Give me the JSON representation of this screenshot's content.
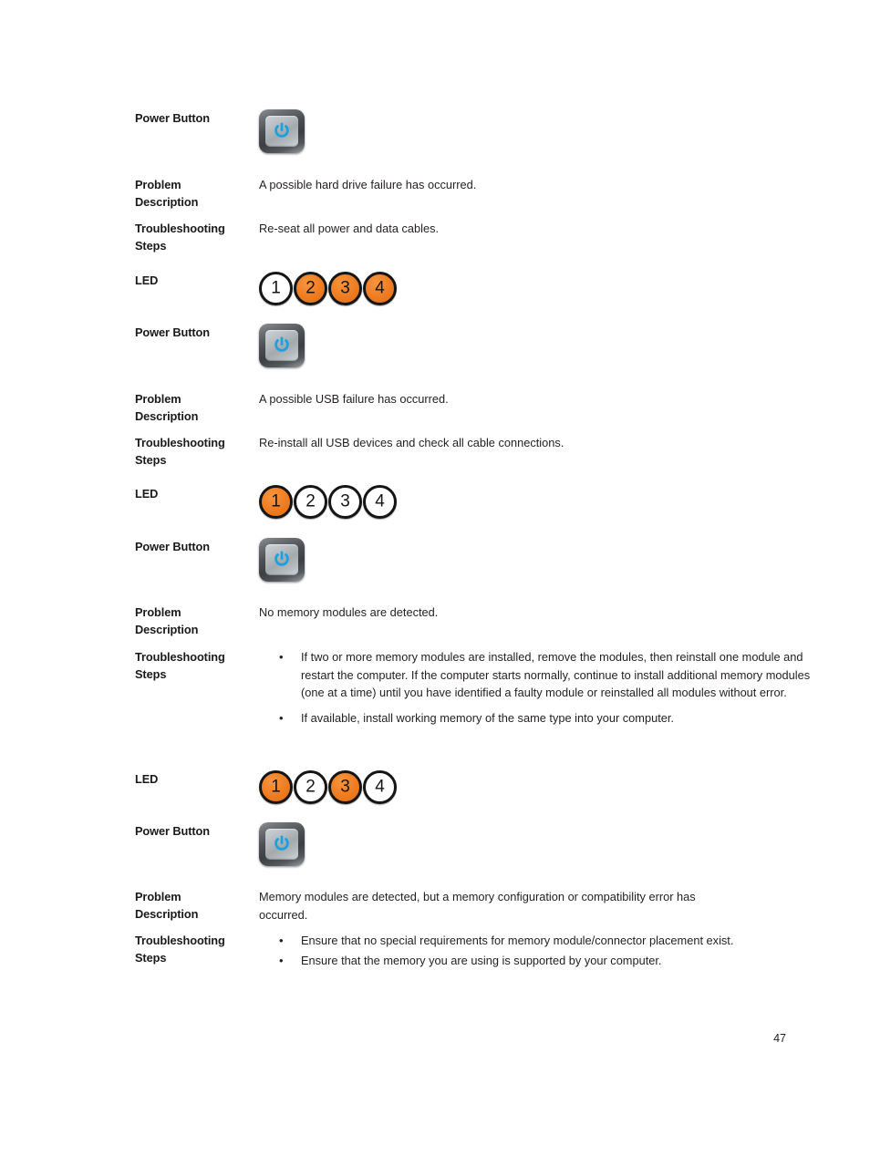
{
  "page": {
    "number": "47",
    "colors": {
      "led_on": "#ef7c20",
      "led_off": "#ffffff",
      "power_glyph": "#1ba1e2",
      "text": "#231f20"
    }
  },
  "labels": {
    "power_button": "Power Button",
    "problem_description_line1": "Problem",
    "problem_description_line2": "Description",
    "troubleshooting_line1": "Troubleshooting",
    "troubleshooting_line2": "Steps",
    "led": "LED"
  },
  "icons": {
    "power_button": "power-button-icon",
    "bullet": "•"
  },
  "sections": [
    {
      "id": "hard-drive-failure",
      "power_button_label": "Power Button",
      "problem_description": "A possible hard drive failure has occurred.",
      "troubleshooting_text": "Re-seat all power and data cables.",
      "troubleshooting_bullets": [],
      "led_label": "LED",
      "leds": [
        {
          "number": "1",
          "state": "off"
        },
        {
          "number": "2",
          "state": "on"
        },
        {
          "number": "3",
          "state": "on"
        },
        {
          "number": "4",
          "state": "on"
        }
      ]
    },
    {
      "id": "usb-failure",
      "power_button_label": "Power Button",
      "problem_description": "A possible USB failure has occurred.",
      "troubleshooting_text": "Re-install all USB devices and check all cable connections.",
      "troubleshooting_bullets": [],
      "led_label": "LED",
      "leds": [
        {
          "number": "1",
          "state": "on"
        },
        {
          "number": "2",
          "state": "off"
        },
        {
          "number": "3",
          "state": "off"
        },
        {
          "number": "4",
          "state": "off"
        }
      ]
    },
    {
      "id": "no-memory-modules",
      "power_button_label": "Power Button",
      "problem_description": "No memory modules are detected.",
      "troubleshooting_text": "",
      "troubleshooting_bullets": [
        "If two or more memory modules are installed, remove the modules, then reinstall one module and restart the computer. If the computer starts normally, continue to install additional memory modules (one at a time) until you have identified a faulty module or reinstalled all modules without error.",
        "If available, install working memory of the same type into your computer."
      ],
      "led_label": "LED",
      "leds": [
        {
          "number": "1",
          "state": "on"
        },
        {
          "number": "2",
          "state": "off"
        },
        {
          "number": "3",
          "state": "on"
        },
        {
          "number": "4",
          "state": "off"
        }
      ]
    },
    {
      "id": "memory-configuration-error",
      "power_button_label": "Power Button",
      "problem_description": "Memory modules are detected, but a memory configuration or compatibility error has occurred.",
      "troubleshooting_text": "",
      "troubleshooting_bullets": [
        "Ensure that no special requirements for memory module/connector placement exist.",
        "Ensure that the memory you are using is supported by your computer."
      ],
      "led_label": "",
      "leds": []
    }
  ]
}
